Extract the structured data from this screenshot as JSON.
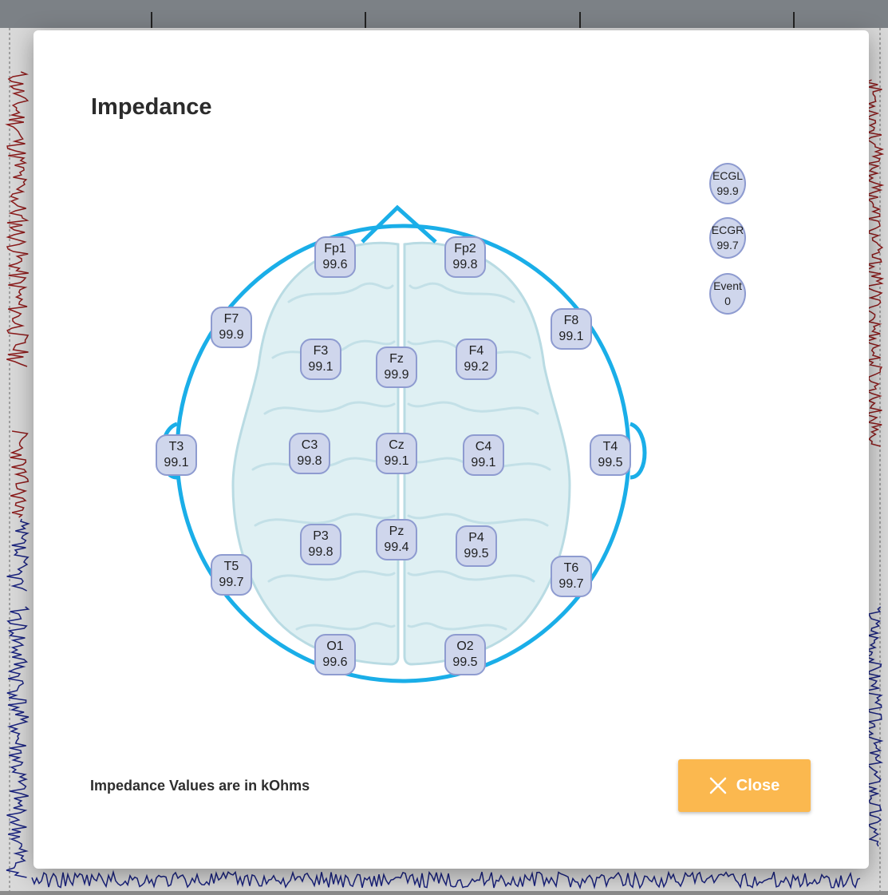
{
  "dialog": {
    "title": "Impedance",
    "units_note": "Impedance Values are in kOhms",
    "close_label": "Close",
    "close_icon": "close-icon"
  },
  "electrodes": [
    {
      "name": "Fp1",
      "value": "99.6"
    },
    {
      "name": "Fp2",
      "value": "99.8"
    },
    {
      "name": "F7",
      "value": "99.9"
    },
    {
      "name": "F3",
      "value": "99.1"
    },
    {
      "name": "Fz",
      "value": "99.9"
    },
    {
      "name": "F4",
      "value": "99.2"
    },
    {
      "name": "F8",
      "value": "99.1"
    },
    {
      "name": "T3",
      "value": "99.1"
    },
    {
      "name": "C3",
      "value": "99.8"
    },
    {
      "name": "Cz",
      "value": "99.1"
    },
    {
      "name": "C4",
      "value": "99.1"
    },
    {
      "name": "T4",
      "value": "99.5"
    },
    {
      "name": "P3",
      "value": "99.8"
    },
    {
      "name": "Pz",
      "value": "99.4"
    },
    {
      "name": "P4",
      "value": "99.5"
    },
    {
      "name": "T5",
      "value": "99.7"
    },
    {
      "name": "T6",
      "value": "99.7"
    },
    {
      "name": "O1",
      "value": "99.6"
    },
    {
      "name": "O2",
      "value": "99.5"
    }
  ],
  "aux_channels": [
    {
      "name": "ECGL",
      "value": "99.9"
    },
    {
      "name": "ECGR",
      "value": "99.7"
    },
    {
      "name": "Event",
      "value": "0"
    }
  ],
  "colors": {
    "head_outline": "#1aaee8",
    "electrode_fill": "#cfd6ec",
    "electrode_border": "#8e9bd0",
    "brain_fill": "#dcefF2",
    "close_button": "#fbb84f",
    "eeg_trace_red": "#8b1a1a",
    "eeg_trace_blue": "#1a237e"
  }
}
